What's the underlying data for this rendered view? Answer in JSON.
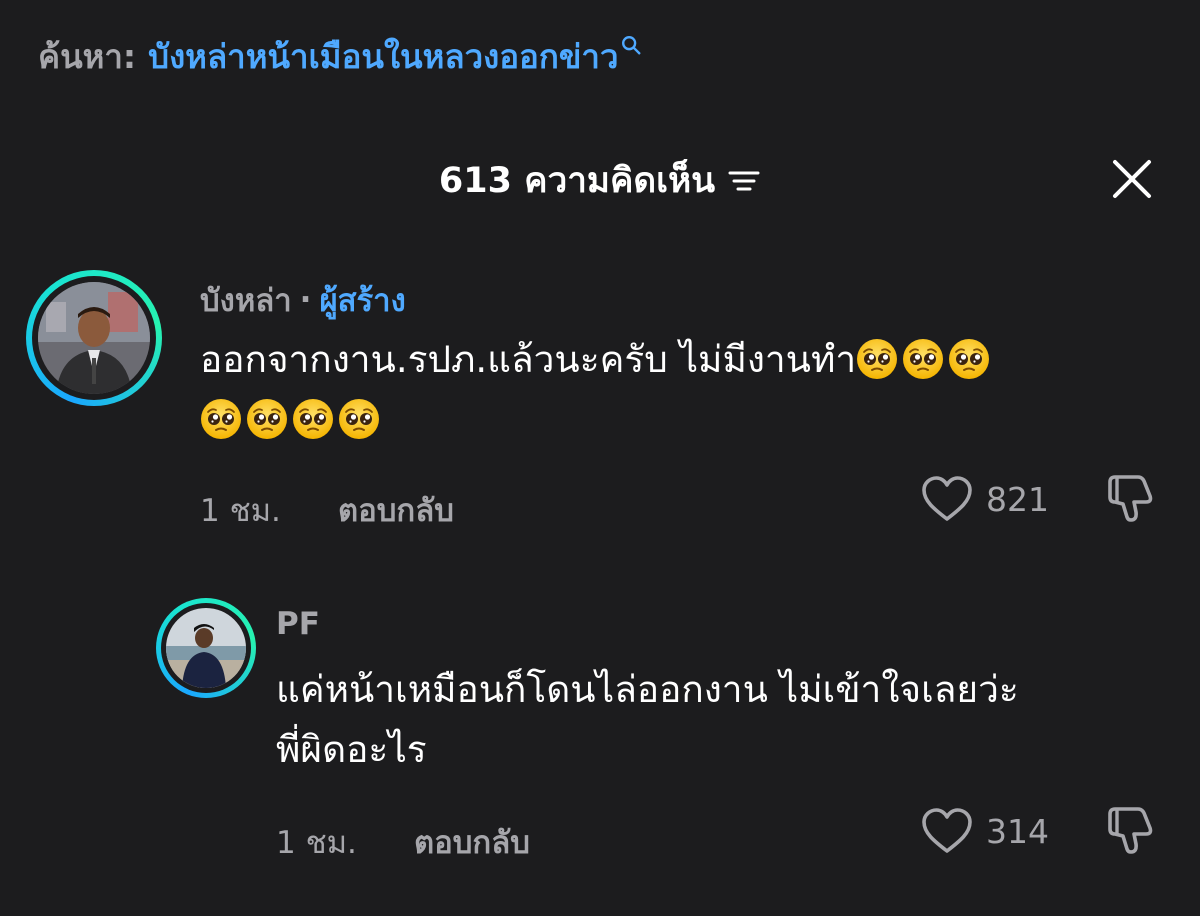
{
  "search": {
    "prefix": "ค้นหา:",
    "query": "บังหล่าหน้าเมือนในหลวงออกข่าว",
    "icon": "search-icon"
  },
  "header": {
    "title": "613 ความคิดเห็น",
    "sort_icon": "sort-icon",
    "close_icon": "close-icon"
  },
  "colors": {
    "background": "#1c1c1e",
    "accent": "#4fa9ff",
    "muted": "#a6a6ab"
  },
  "comments": [
    {
      "username": "บังหล่า",
      "separator": "·",
      "badge": "ผู้สร้าง",
      "text_line1": "ออกจากงาน.รปภ.แล้วนะครับ ไม่มีงานทำ",
      "emoji": "pleading-face",
      "emoji_count_line1": 3,
      "emoji_count_line2": 4,
      "time": "1 ชม.",
      "reply_label": "ตอบกลับ",
      "likes": "821"
    },
    {
      "username": "PF",
      "text_line1": "แค่หน้าเหมือนก็โดนไล่ออกงาน ไม่เข้าใจเลยว่ะ",
      "text_line2": "พี่ผิดอะไร",
      "time": "1 ชม.",
      "reply_label": "ตอบกลับ",
      "likes": "314"
    }
  ]
}
